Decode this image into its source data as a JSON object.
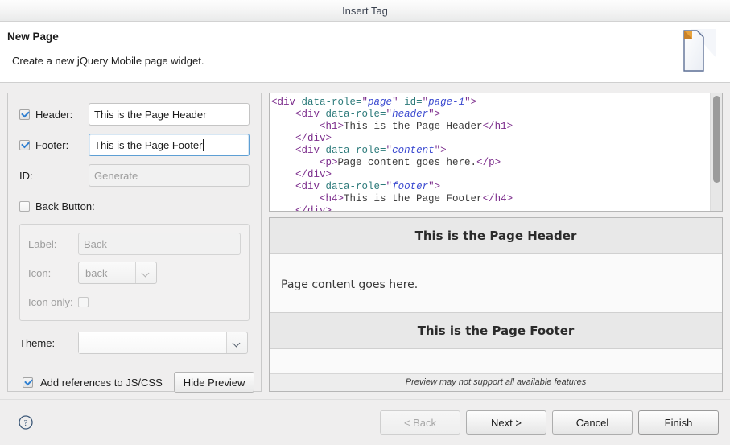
{
  "window": {
    "title": "Insert Tag"
  },
  "header": {
    "title": "New Page",
    "description": "Create a new jQuery Mobile page widget.",
    "icon": "new-page-document-icon"
  },
  "form": {
    "header_field": {
      "label": "Header:",
      "checked": true,
      "value": "This is the Page Header"
    },
    "footer_field": {
      "label": "Footer:",
      "checked": true,
      "value": "This is the Page Footer",
      "focused": true
    },
    "id_field": {
      "label": "ID:",
      "value": "",
      "placeholder": "Generate"
    },
    "back_button": {
      "label": "Back Button:",
      "checked": false,
      "enabled": false,
      "label_field": {
        "label": "Label:",
        "value": "",
        "placeholder": "Back"
      },
      "icon_field": {
        "label": "Icon:",
        "value": "back"
      },
      "icon_only_field": {
        "label": "Icon only:",
        "checked": false
      }
    },
    "theme": {
      "label": "Theme:",
      "value": ""
    },
    "add_references": {
      "label": "Add references to JS/CSS",
      "checked": true
    },
    "hide_preview_label": "Hide Preview"
  },
  "code": {
    "lines": [
      [
        {
          "t": "tag",
          "s": "<div "
        },
        {
          "t": "attr",
          "s": "data-role="
        },
        {
          "t": "tag",
          "s": "\""
        },
        {
          "t": "val",
          "s": "page"
        },
        {
          "t": "tag",
          "s": "\" "
        },
        {
          "t": "attr",
          "s": "id="
        },
        {
          "t": "tag",
          "s": "\""
        },
        {
          "t": "val",
          "s": "page-1"
        },
        {
          "t": "tag",
          "s": "\">"
        }
      ],
      [
        {
          "t": "txtnode",
          "s": "    "
        },
        {
          "t": "tag",
          "s": "<div "
        },
        {
          "t": "attr",
          "s": "data-role="
        },
        {
          "t": "tag",
          "s": "\""
        },
        {
          "t": "val",
          "s": "header"
        },
        {
          "t": "tag",
          "s": "\">"
        }
      ],
      [
        {
          "t": "txtnode",
          "s": "        "
        },
        {
          "t": "tag",
          "s": "<h1>"
        },
        {
          "t": "txtnode",
          "s": "This is the Page Header"
        },
        {
          "t": "tag",
          "s": "</h1>"
        }
      ],
      [
        {
          "t": "txtnode",
          "s": "    "
        },
        {
          "t": "tag",
          "s": "</div>"
        }
      ],
      [
        {
          "t": "txtnode",
          "s": "    "
        },
        {
          "t": "tag",
          "s": "<div "
        },
        {
          "t": "attr",
          "s": "data-role="
        },
        {
          "t": "tag",
          "s": "\""
        },
        {
          "t": "val",
          "s": "content"
        },
        {
          "t": "tag",
          "s": "\">"
        }
      ],
      [
        {
          "t": "txtnode",
          "s": "        "
        },
        {
          "t": "tag",
          "s": "<p>"
        },
        {
          "t": "txtnode",
          "s": "Page content goes here."
        },
        {
          "t": "tag",
          "s": "</p>"
        }
      ],
      [
        {
          "t": "txtnode",
          "s": "    "
        },
        {
          "t": "tag",
          "s": "</div>"
        }
      ],
      [
        {
          "t": "txtnode",
          "s": "    "
        },
        {
          "t": "tag",
          "s": "<div "
        },
        {
          "t": "attr",
          "s": "data-role="
        },
        {
          "t": "tag",
          "s": "\""
        },
        {
          "t": "val",
          "s": "footer"
        },
        {
          "t": "tag",
          "s": "\">"
        }
      ],
      [
        {
          "t": "txtnode",
          "s": "        "
        },
        {
          "t": "tag",
          "s": "<h4>"
        },
        {
          "t": "txtnode",
          "s": "This is the Page Footer"
        },
        {
          "t": "tag",
          "s": "</h4>"
        }
      ],
      [
        {
          "t": "txtnode",
          "s": "    "
        },
        {
          "t": "tag",
          "s": "</div>"
        }
      ]
    ]
  },
  "preview": {
    "header_text": "This is the Page Header",
    "content_text": "Page content goes here.",
    "footer_text": "This is the Page Footer",
    "note": "Preview may not support all available features"
  },
  "buttons": {
    "back": {
      "label": "< Back",
      "enabled": false
    },
    "next": {
      "label": "Next >",
      "enabled": true
    },
    "cancel": {
      "label": "Cancel",
      "enabled": true
    },
    "finish": {
      "label": "Finish",
      "enabled": true
    },
    "help_icon": "help-question-icon"
  },
  "colors": {
    "accent": "#2f7fd1",
    "tag": "#7c2d8c",
    "attribute": "#2c7a7a",
    "value": "#3b4ad0",
    "dialog_bg": "#efeeee"
  }
}
